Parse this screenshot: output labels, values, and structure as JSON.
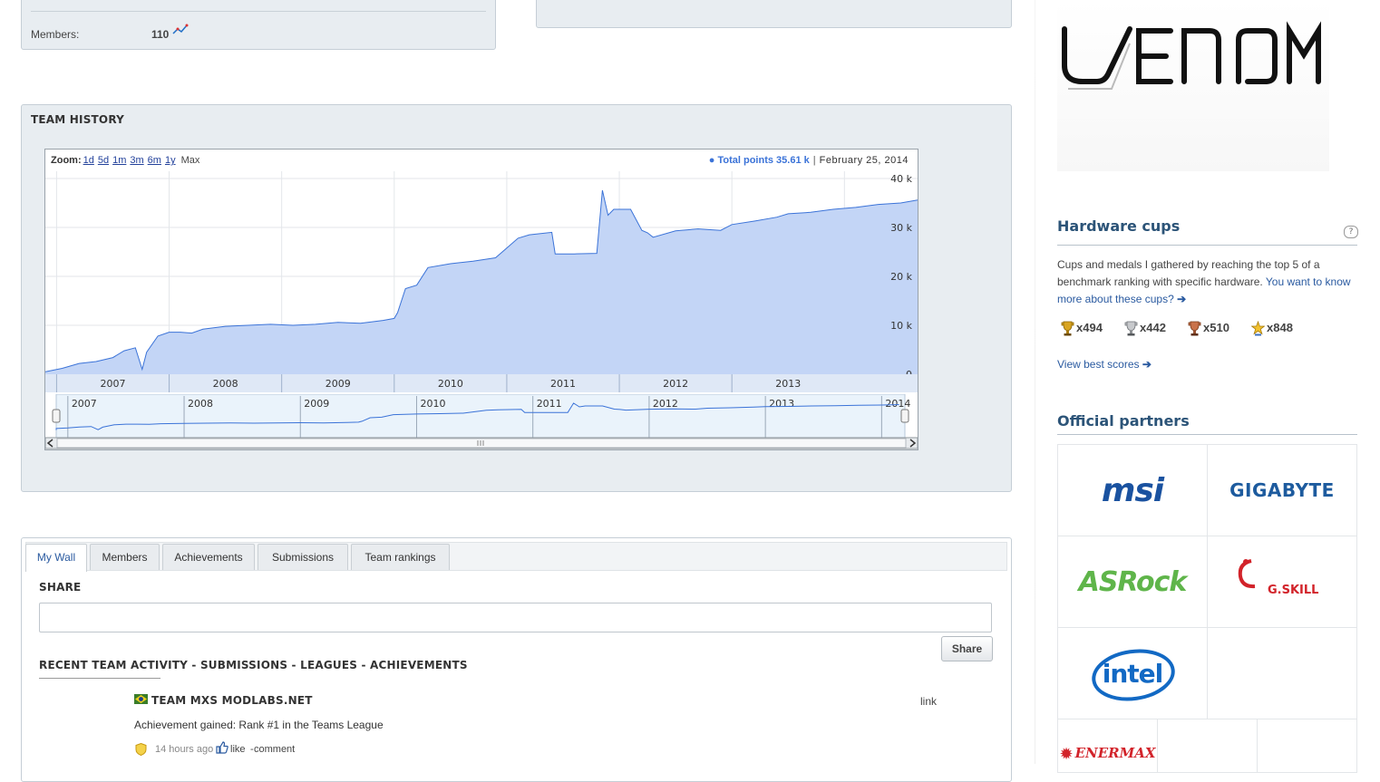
{
  "members_panel": {
    "label": "Members:",
    "value": "110"
  },
  "team_history": {
    "title": "TEAM HISTORY",
    "zoom_label": "Zoom:",
    "zoom_options": [
      "1d",
      "5d",
      "1m",
      "3m",
      "6m",
      "1y"
    ],
    "zoom_max": "Max",
    "legend_series": "Total points 35.61 k",
    "legend_date": "February 25, 2014",
    "navigator_years": [
      "2007",
      "2008",
      "2009",
      "2010",
      "2011",
      "2012",
      "2013",
      "2014"
    ]
  },
  "chart_data": {
    "type": "area",
    "x_tick_labels": [
      "2007",
      "2008",
      "2009",
      "2010",
      "2011",
      "2012",
      "2013"
    ],
    "y_tick_labels": [
      "40 k",
      "30 k",
      "20 k",
      "10 k",
      "0"
    ],
    "ylim": [
      0,
      40000
    ],
    "xlim": [
      2006.4,
      2014.15
    ],
    "grid": true,
    "accent_color": "#3b73d8",
    "fill_color": "#c3d5f6",
    "series": [
      {
        "name": "Total points",
        "x": [
          2006.4,
          2006.55,
          2006.7,
          2006.85,
          2007.0,
          2007.1,
          2007.2,
          2007.26,
          2007.3,
          2007.4,
          2007.5,
          2007.6,
          2007.7,
          2007.8,
          2008.0,
          2008.2,
          2008.4,
          2008.6,
          2008.8,
          2009.0,
          2009.2,
          2009.4,
          2009.5,
          2009.53,
          2009.6,
          2009.7,
          2009.8,
          2010.0,
          2010.2,
          2010.4,
          2010.5,
          2010.6,
          2010.7,
          2010.9,
          2010.93,
          2011.1,
          2011.3,
          2011.35,
          2011.4,
          2011.45,
          2011.6,
          2011.7,
          2011.75,
          2011.8,
          2012.0,
          2012.2,
          2012.4,
          2012.5,
          2012.7,
          2012.9,
          2013.0,
          2013.2,
          2013.4,
          2013.6,
          2013.8,
          2014.0,
          2014.15
        ],
        "y": [
          500,
          1200,
          2200,
          2600,
          3400,
          4800,
          5400,
          1000,
          4500,
          7800,
          8600,
          8600,
          8400,
          9200,
          9800,
          10000,
          10200,
          10000,
          10200,
          10600,
          10400,
          11000,
          11400,
          12600,
          17500,
          18200,
          21800,
          22600,
          23100,
          23800,
          25800,
          27800,
          28500,
          29000,
          24600,
          24600,
          24700,
          37600,
          32500,
          33700,
          33700,
          29400,
          28900,
          28000,
          29300,
          29700,
          29400,
          30600,
          31300,
          32100,
          32800,
          33100,
          33700,
          34100,
          34700,
          35000,
          35610
        ]
      }
    ]
  },
  "wall": {
    "tabs": [
      "My Wall",
      "Members",
      "Achievements",
      "Submissions",
      "Team rankings"
    ],
    "share_heading": "SHARE",
    "share_button": "Share",
    "activity_heading": "RECENT TEAM ACTIVITY - SUBMISSIONS - LEAGUES - ACHIEVEMENTS",
    "activity": {
      "team_name": "TEAM MXS MODLABS.NET",
      "link": "link",
      "text": "Achievement gained: Rank #1 in the Teams League",
      "time": "14 hours ago",
      "like": "like",
      "separator": " - ",
      "comment": "comment"
    }
  },
  "sidebar": {
    "logo_text": "VENOM",
    "hardware_cups": {
      "title": "Hardware cups",
      "desc": "Cups and medals I gathered by reaching the top 5 of a benchmark ranking with specific hardware.",
      "link": "You want to know more about these cups?",
      "counts": [
        "x494",
        "x442",
        "x510",
        "x848"
      ],
      "view_best": "View best scores"
    },
    "partners": {
      "title": "Official partners",
      "logos": [
        "msi",
        "GIGABYTE",
        "ASRock",
        "G.SKILL",
        "intel",
        "ENERMAX"
      ]
    }
  }
}
